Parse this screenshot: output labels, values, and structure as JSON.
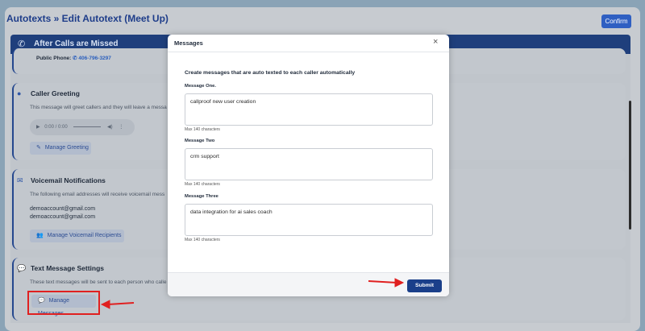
{
  "page": {
    "title": "Autotexts » Edit Autotext (Meet Up)",
    "confirm_label": "Confirm"
  },
  "section": {
    "title": "After Calls are Missed",
    "icon": "missed-call-icon"
  },
  "public_phone": {
    "label": "Public Phone:",
    "number": "406-796-3297"
  },
  "caller_greeting": {
    "title": "Caller Greeting",
    "description": "This message will greet callers and they will leave a messa",
    "audio_time": "0:00 / 0:00",
    "manage_label": "Manage Greeting"
  },
  "voicemail": {
    "title": "Voicemail Notifications",
    "description": "The following email addresses will receive voicemail mess",
    "emails": [
      "demoaccount@gmail.com",
      "demoaccount@gmail.com"
    ],
    "manage_label": "Manage Voicemail Recipients"
  },
  "text_settings": {
    "title": "Text Message Settings",
    "description": "These text messages will be sent to each person who calle",
    "manage_label": "Manage Messages"
  },
  "modal": {
    "title": "Messages",
    "close_symbol": "×",
    "intro": "Create messages that are auto texted to each caller automatically",
    "messages": [
      {
        "label": "Message One.",
        "value": "callproof new user creation",
        "hint": "Max 140 characters"
      },
      {
        "label": "Message Two",
        "value": "crm support",
        "hint": "Max 140 characters"
      },
      {
        "label": "Message Three",
        "value": "data integration for ai sales coach",
        "hint": "Max 140 characters"
      }
    ],
    "submit_label": "Submit"
  },
  "colors": {
    "primary": "#1a3f8a",
    "header": "#1f3f7c",
    "annotation": "#e02020"
  }
}
